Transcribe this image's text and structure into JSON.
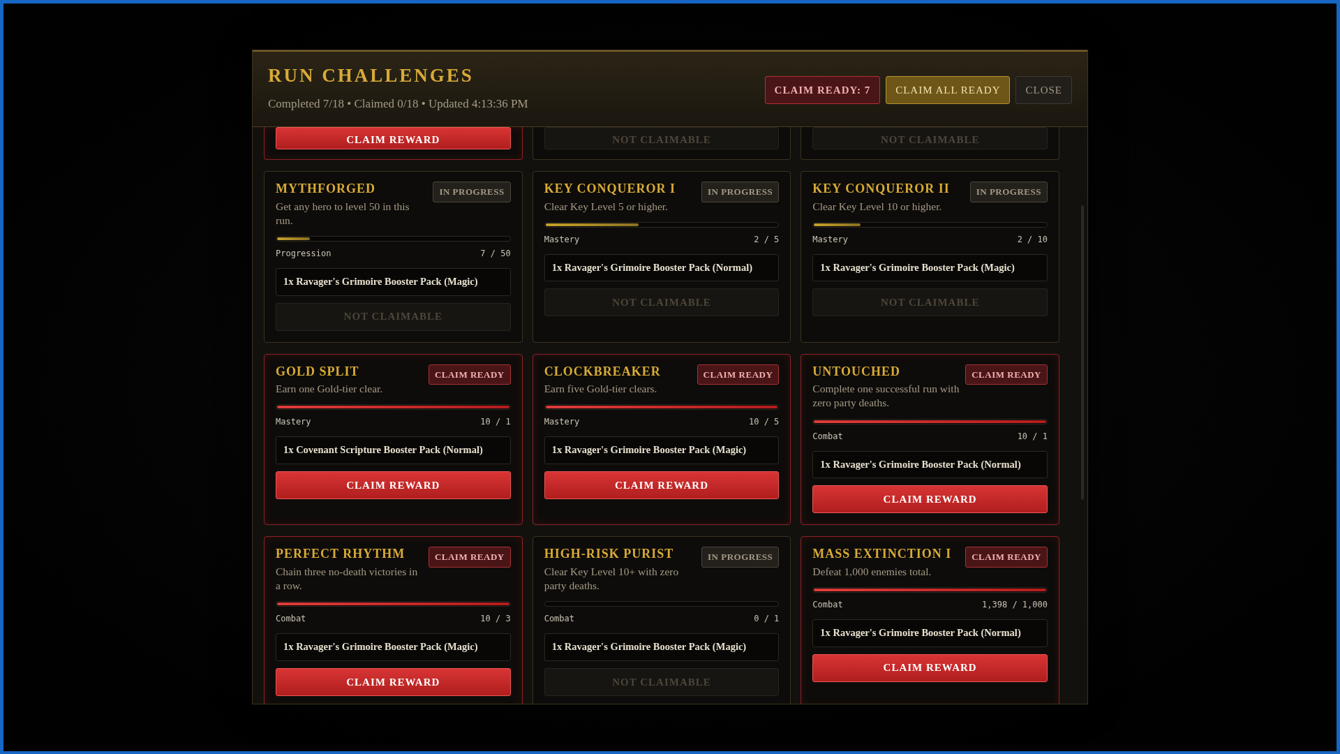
{
  "title": "RUN CHALLENGES",
  "subtitle": "Completed 7/18 • Claimed 0/18 • Updated 4:13:36 PM",
  "header_buttons": [
    {
      "label": "CLAIM READY: 7",
      "kind": "count"
    },
    {
      "label": "CLAIM ALL READY",
      "kind": "primary"
    },
    {
      "label": "CLOSE",
      "kind": "close"
    }
  ],
  "cut_row": [
    {
      "claim_ready": true,
      "button": "CLAIM REWARD"
    },
    {
      "claim_ready": false,
      "button": "NOT CLAIMABLE"
    },
    {
      "claim_ready": false,
      "button": "NOT CLAIMABLE"
    }
  ],
  "challenges": [
    {
      "title": "MYTHFORGED",
      "badge": "IN PROGRESS",
      "claim_ready": false,
      "description": "Get any hero to level 50 in this run.",
      "level": 0.14,
      "category": "Progression",
      "progress": "7 / 50",
      "reward": "1x Ravager's Grimoire Booster Pack (Magic)",
      "button": "NOT CLAIMABLE"
    },
    {
      "title": "KEY CONQUEROR I",
      "badge": "IN PROGRESS",
      "claim_ready": false,
      "description": "Clear Key Level 5 or higher.",
      "level": 0.4,
      "category": "Mastery",
      "progress": "2 / 5",
      "reward": "1x Ravager's Grimoire Booster Pack (Normal)",
      "button": "NOT CLAIMABLE"
    },
    {
      "title": "KEY CONQUEROR II",
      "badge": "IN PROGRESS",
      "claim_ready": false,
      "description": "Clear Key Level 10 or higher.",
      "level": 0.2,
      "category": "Mastery",
      "progress": "2 / 10",
      "reward": "1x Ravager's Grimoire Booster Pack (Magic)",
      "button": "NOT CLAIMABLE"
    },
    {
      "title": "GOLD SPLIT",
      "badge": "CLAIM READY",
      "claim_ready": true,
      "description": "Earn one Gold-tier clear.",
      "level": 1,
      "category": "Mastery",
      "progress": "10 / 1",
      "reward": "1x Covenant Scripture Booster Pack (Normal)",
      "button": "CLAIM REWARD"
    },
    {
      "title": "CLOCKBREAKER",
      "badge": "CLAIM READY",
      "claim_ready": true,
      "description": "Earn five Gold-tier clears.",
      "level": 1,
      "category": "Mastery",
      "progress": "10 / 5",
      "reward": "1x Ravager's Grimoire Booster Pack (Magic)",
      "button": "CLAIM REWARD"
    },
    {
      "title": "UNTOUCHED",
      "badge": "CLAIM READY",
      "claim_ready": true,
      "description": "Complete one successful run with zero party deaths.",
      "level": 1,
      "category": "Combat",
      "progress": "10 / 1",
      "reward": "1x Ravager's Grimoire Booster Pack (Normal)",
      "button": "CLAIM REWARD"
    },
    {
      "title": "PERFECT RHYTHM",
      "badge": "CLAIM READY",
      "claim_ready": true,
      "description": "Chain three no-death victories in a row.",
      "level": 1,
      "category": "Combat",
      "progress": "10 / 3",
      "reward": "1x Ravager's Grimoire Booster Pack (Magic)",
      "button": "CLAIM REWARD"
    },
    {
      "title": "HIGH-RISK PURIST",
      "badge": "IN PROGRESS",
      "claim_ready": false,
      "description": "Clear Key Level 10+ with zero party deaths.",
      "level": 0,
      "category": "Combat",
      "progress": "0 / 1",
      "reward": "1x Ravager's Grimoire Booster Pack (Magic)",
      "button": "NOT CLAIMABLE"
    },
    {
      "title": "MASS EXTINCTION I",
      "badge": "CLAIM READY",
      "claim_ready": true,
      "description": "Defeat 1,000 enemies total.",
      "level": 1,
      "category": "Combat",
      "progress": "1,398 / 1,000",
      "reward": "1x Ravager's Grimoire Booster Pack (Normal)",
      "button": "CLAIM REWARD"
    }
  ]
}
